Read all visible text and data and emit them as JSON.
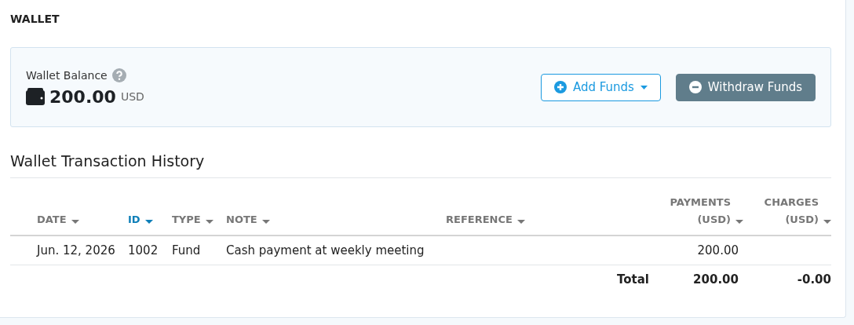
{
  "page_title": "WALLET",
  "balance": {
    "label": "Wallet Balance",
    "amount": "200.00",
    "currency": "USD"
  },
  "buttons": [
    {
      "kind": "add",
      "label": "Add Funds"
    },
    {
      "kind": "withdraw",
      "label": "Withdraw Funds"
    }
  ],
  "history": {
    "title": "Wallet Transaction History",
    "columns": [
      {
        "label": "DATE",
        "selected": false
      },
      {
        "label": "ID",
        "selected": true
      },
      {
        "label": "TYPE",
        "selected": false
      },
      {
        "label": "NOTE",
        "selected": false
      },
      {
        "label": "REFERENCE",
        "selected": false
      },
      {
        "label": "PAYMENTS (USD)",
        "selected": false
      },
      {
        "label": "CHARGES (USD)",
        "selected": false
      }
    ],
    "rows": [
      {
        "date": "Jun. 12, 2026",
        "id": "1002",
        "type": "Fund",
        "note": "Cash payment at weekly meeting",
        "payments": "200.00"
      }
    ],
    "total": {
      "label": "Total",
      "payments": "200.00",
      "charges": "-0.00"
    }
  }
}
